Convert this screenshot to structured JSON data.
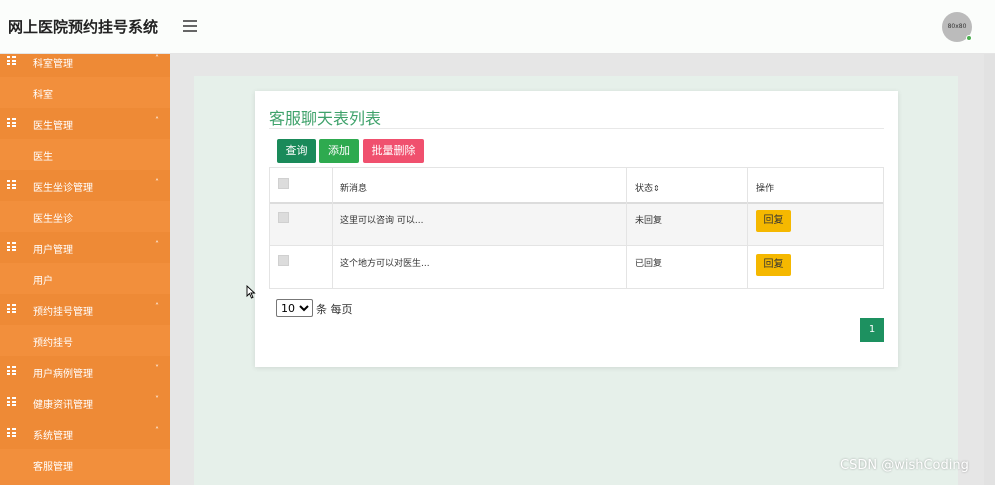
{
  "app": {
    "title": "网上医院预约挂号系统",
    "avatar_text": "80x80"
  },
  "sidebar": {
    "groups": [
      {
        "label": "科室管理",
        "caret": "˄",
        "item": "科室"
      },
      {
        "label": "医生管理",
        "caret": "˄",
        "item": "医生"
      },
      {
        "label": "医生坐诊管理",
        "caret": "˄",
        "item": "医生坐诊"
      },
      {
        "label": "用户管理",
        "caret": "˄",
        "item": "用户"
      },
      {
        "label": "预约挂号管理",
        "caret": "˄",
        "item": "预约挂号"
      },
      {
        "label": "用户病例管理",
        "caret": "˅"
      },
      {
        "label": "健康资讯管理",
        "caret": "˅"
      },
      {
        "label": "系统管理",
        "caret": "˄",
        "item": "客服管理"
      }
    ]
  },
  "main": {
    "title": "客服聊天表列表",
    "buttons": {
      "query": "查询",
      "add": "添加",
      "batch_delete": "批量删除"
    },
    "table": {
      "headers": {
        "message": "新消息",
        "status": "状态",
        "status_sort_icon": "⇕",
        "action": "操作"
      },
      "rows": [
        {
          "message": "这里可以咨询 可以...",
          "status": "未回复",
          "action": "回复"
        },
        {
          "message": "这个地方可以对医生...",
          "status": "已回复",
          "action": "回复"
        }
      ]
    },
    "pagination": {
      "page_size": "10",
      "page_size_suffix": "条 每页",
      "current_page": "1"
    }
  },
  "watermark": "CSDN @wishCoding",
  "colors": {
    "sidebar": "#f08d3c",
    "accent_green": "#1d9160",
    "delete_red": "#f0506e",
    "reply_yellow": "#f5b800"
  }
}
